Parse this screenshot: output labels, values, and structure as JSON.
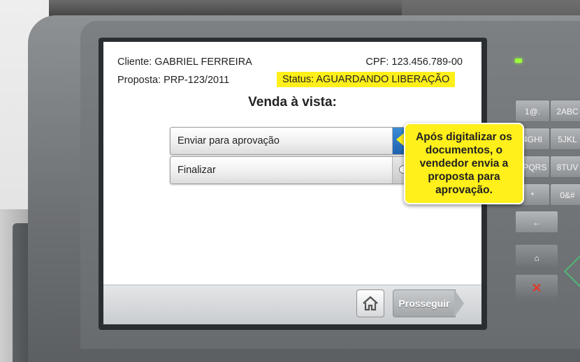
{
  "screen": {
    "customer": "Cliente: GABRIEL FERREIRA",
    "cpf": "CPF: 123.456.789-00",
    "proposal": "Proposta: PRP-123/2011",
    "status": "Status: AGUARDANDO LIBERAÇÃO",
    "title": "Venda à vista:",
    "options": [
      {
        "label": "Enviar para aprovação",
        "selected": true
      },
      {
        "label": "Finalizar",
        "selected": false
      }
    ],
    "proceed_label": "Prosseguir"
  },
  "callout": {
    "text": "Após digitalizar os documentos, o vendedor envia a proposta para aprovação."
  },
  "keypad": {
    "keys": [
      "1@.",
      "2ABC",
      "4GHI",
      "5JKL",
      "7PQRS",
      "8TUV",
      "*",
      "0&#",
      "←"
    ]
  },
  "colors": {
    "highlight": "#ffef1a",
    "selected_radio": "#1d62b0",
    "led": "#9aff3a"
  }
}
